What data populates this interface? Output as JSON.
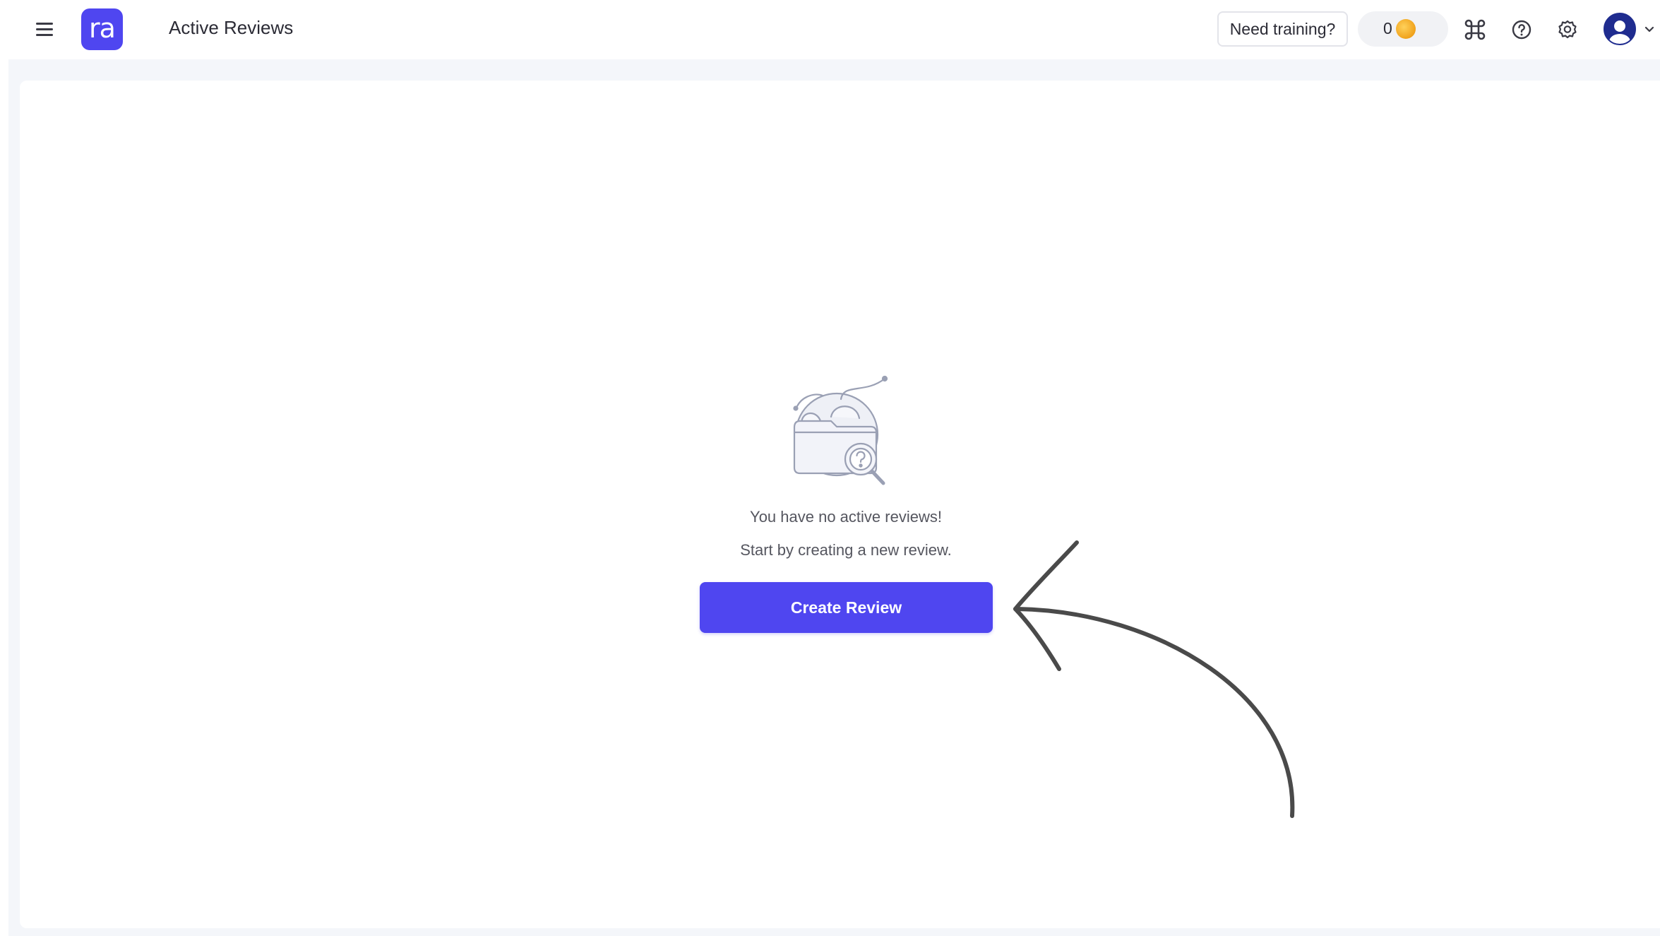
{
  "header": {
    "logo_text": "ra",
    "page_title": "Active Reviews",
    "training_label": "Need training?",
    "coin_count": "0",
    "icons": [
      "menu-icon",
      "command-icon",
      "help-icon",
      "settings-icon",
      "user-avatar-icon",
      "chevron-down-icon",
      "coin-icon"
    ]
  },
  "empty_state": {
    "title": "You have no active reviews!",
    "subtitle": "Start by creating a new review.",
    "button_label": "Create Review",
    "illustration": "folder-search-illustration"
  },
  "annotation": {
    "icon": "hand-drawn-arrow"
  },
  "colors": {
    "brand": "#4f46f0",
    "background": "#f4f6fa",
    "coin": "#f0a21c"
  }
}
